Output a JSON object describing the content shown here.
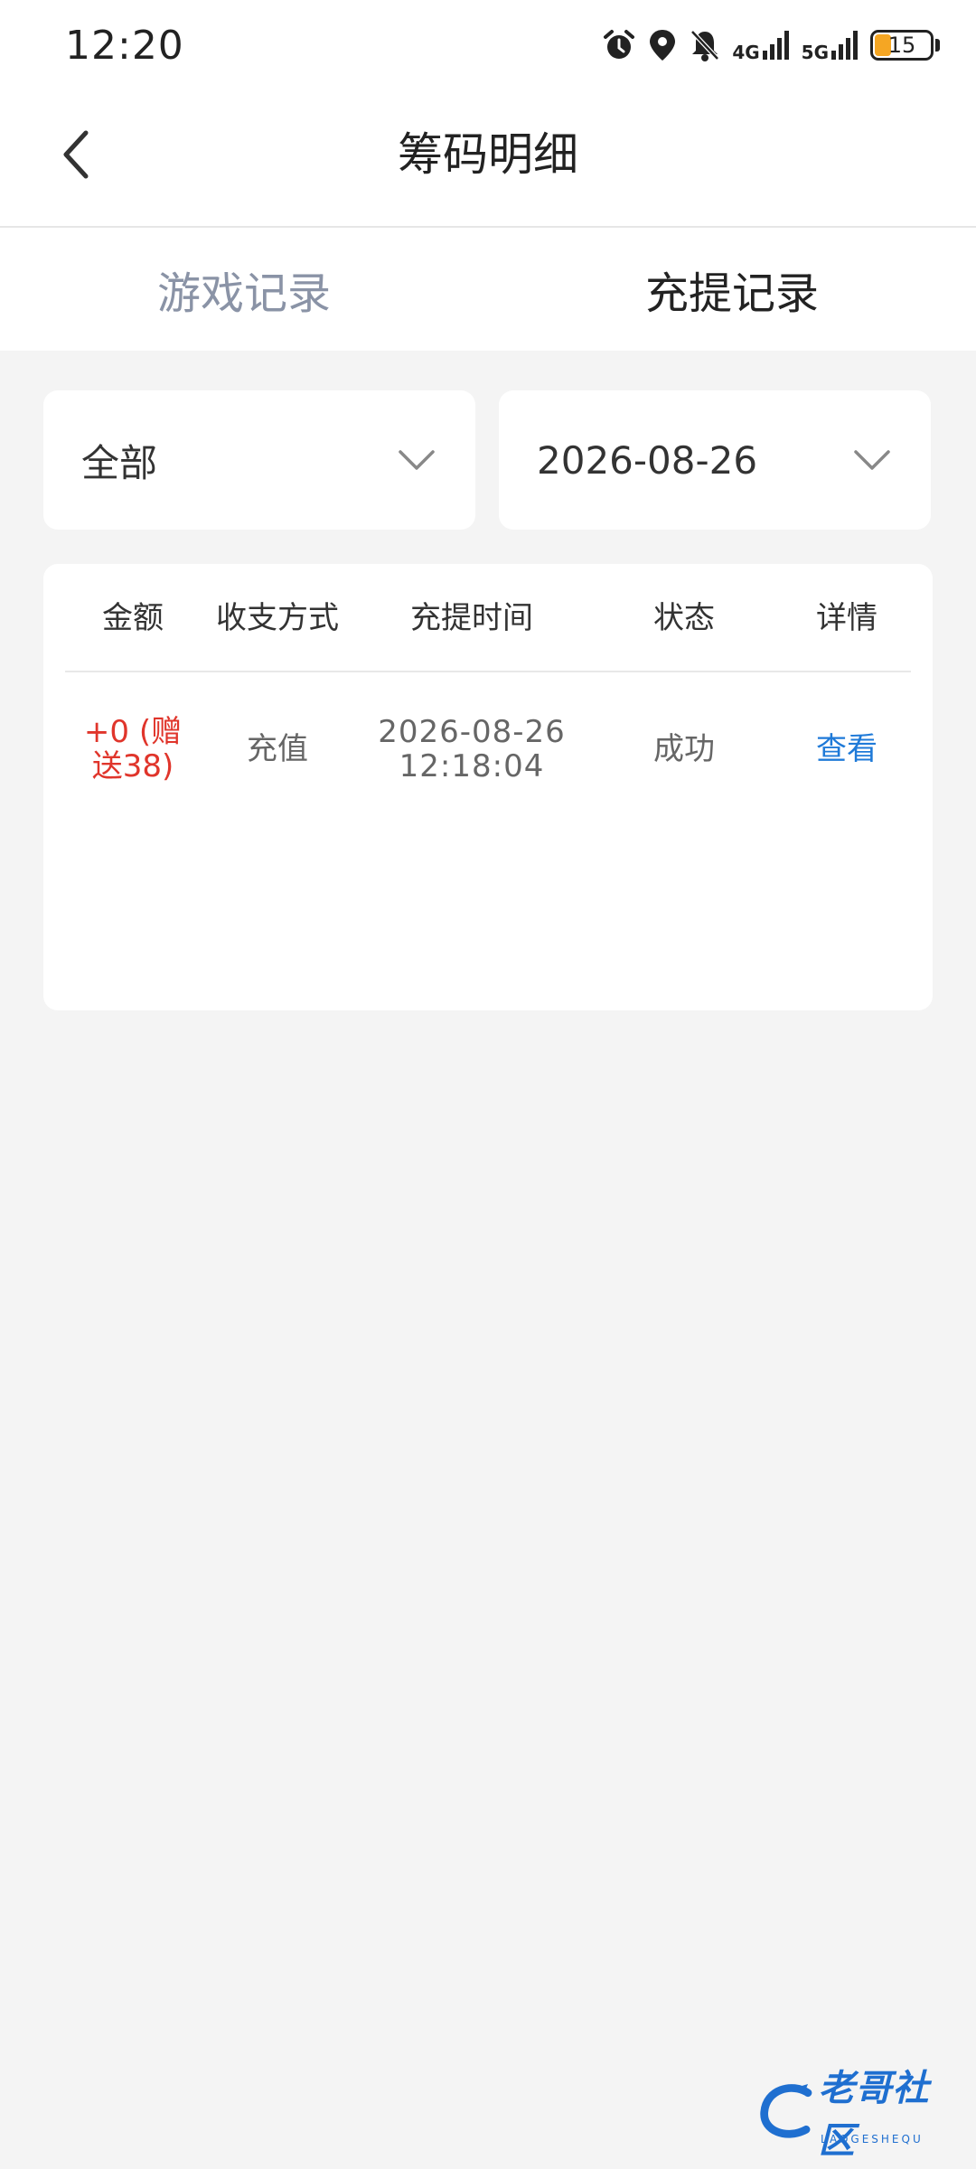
{
  "status_bar": {
    "time": "12:20",
    "network_1": "4G",
    "network_2": "5G",
    "battery": "15",
    "battery_color": "#f5a623"
  },
  "header": {
    "title": "筹码明细",
    "back_icon": "chevron-left-icon"
  },
  "tabs": [
    {
      "label": "游戏记录",
      "active": false
    },
    {
      "label": "充提记录",
      "active": true
    }
  ],
  "filters": {
    "type": "全部",
    "date": "2026-08-26"
  },
  "table": {
    "columns": [
      "金额",
      "收支方式",
      "充提时间",
      "状态",
      "详情"
    ],
    "rows": [
      {
        "amount_line1": "+0 (赠",
        "amount_line2": "送38)",
        "method": "充值",
        "date": "2026-08-26",
        "time": "12:18:04",
        "status": "成功",
        "detail": "查看"
      }
    ]
  },
  "colors": {
    "amount": "#e0352b",
    "link": "#1f7ad8",
    "inactive_tab": "#8a93a6",
    "background": "#f4f4f4"
  },
  "watermark": {
    "text": "老哥社区",
    "sub": "LAOGESHEQU"
  }
}
